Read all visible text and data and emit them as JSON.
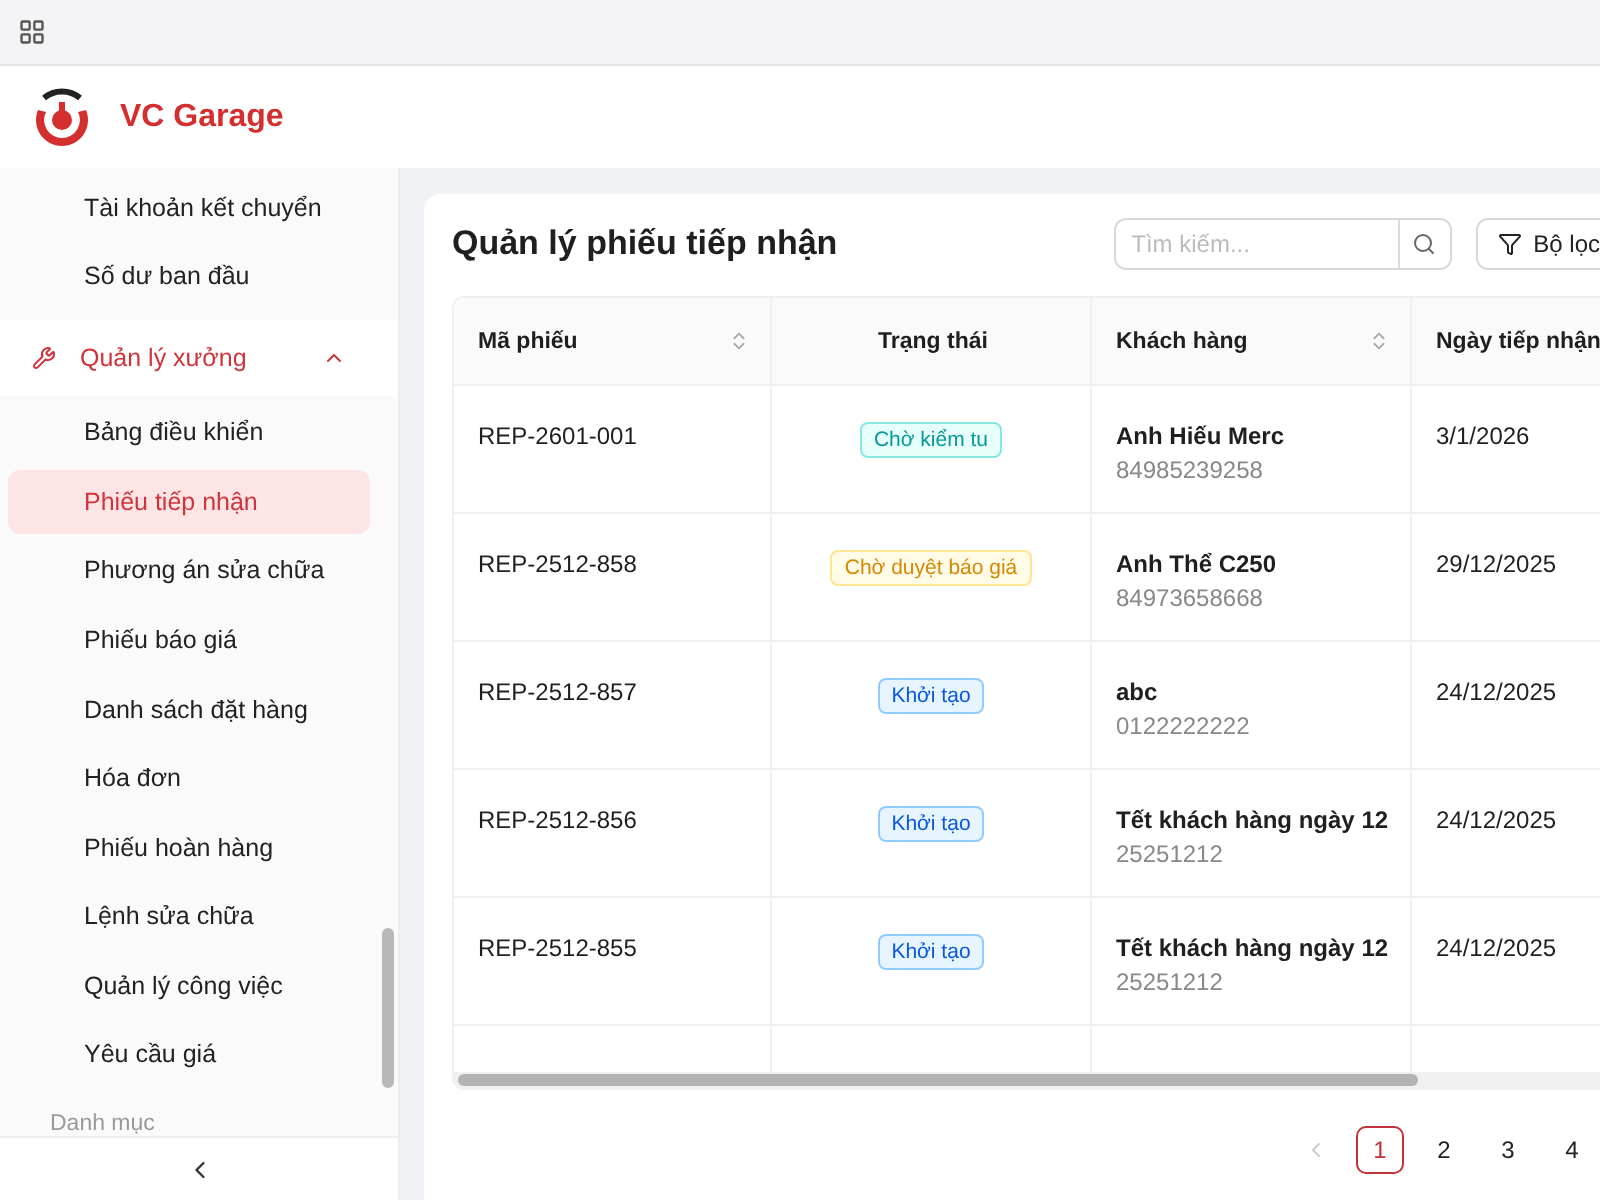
{
  "app": {
    "name": "VC Garage"
  },
  "sidebar": {
    "items": [
      {
        "label": "Tài khoản kết chuyển",
        "selected": false
      },
      {
        "label": "Số dư ban đầu",
        "selected": false
      }
    ],
    "group": {
      "label": "Quản lý xưởng",
      "expanded": true,
      "children": [
        {
          "label": "Bảng điều khiển",
          "selected": false
        },
        {
          "label": "Phiếu tiếp nhận",
          "selected": true
        },
        {
          "label": "Phương án sửa chữa",
          "selected": false
        },
        {
          "label": "Phiếu báo giá",
          "selected": false
        },
        {
          "label": "Danh sách đặt hàng",
          "selected": false
        },
        {
          "label": "Hóa đơn",
          "selected": false
        },
        {
          "label": "Phiếu hoàn hàng",
          "selected": false
        },
        {
          "label": "Lệnh sửa chữa",
          "selected": false
        },
        {
          "label": "Quản lý công việc",
          "selected": false
        },
        {
          "label": "Yêu cầu giá",
          "selected": false
        }
      ]
    },
    "section_label": "Danh mục"
  },
  "page": {
    "title": "Quản lý phiếu tiếp nhận",
    "search": {
      "placeholder": "Tìm kiếm..."
    },
    "filter_button": "Bộ lọc"
  },
  "table": {
    "columns": [
      {
        "label": "Mã phiếu",
        "sortable": true
      },
      {
        "label": "Trạng thái",
        "sortable": false
      },
      {
        "label": "Khách hàng",
        "sortable": true
      },
      {
        "label": "Ngày tiếp nhận",
        "sortable": false
      }
    ],
    "rows": [
      {
        "code": "REP-2601-001",
        "status": {
          "label": "Chờ kiểm tu",
          "kind": "inspect"
        },
        "customer": "Anh Hiếu Merc",
        "phone": "84985239258",
        "date": "3/1/2026"
      },
      {
        "code": "REP-2512-858",
        "status": {
          "label": "Chờ duyệt báo giá",
          "kind": "quote"
        },
        "customer": "Anh Thể C250",
        "phone": "84973658668",
        "date": "29/12/2025"
      },
      {
        "code": "REP-2512-857",
        "status": {
          "label": "Khởi tạo",
          "kind": "new"
        },
        "customer": "abc",
        "phone": "0122222222",
        "date": "24/12/2025"
      },
      {
        "code": "REP-2512-856",
        "status": {
          "label": "Khởi tạo",
          "kind": "new"
        },
        "customer": "Tết khách hàng ngày 12",
        "phone": "25251212",
        "date": "24/12/2025"
      },
      {
        "code": "REP-2512-855",
        "status": {
          "label": "Khởi tạo",
          "kind": "new"
        },
        "customer": "Tết khách hàng ngày 12",
        "phone": "25251212",
        "date": "24/12/2025"
      }
    ]
  },
  "pagination": {
    "pages": [
      {
        "label": "1",
        "selected": true
      },
      {
        "label": "2",
        "selected": false
      },
      {
        "label": "3",
        "selected": false
      },
      {
        "label": "4",
        "selected": false
      }
    ]
  }
}
